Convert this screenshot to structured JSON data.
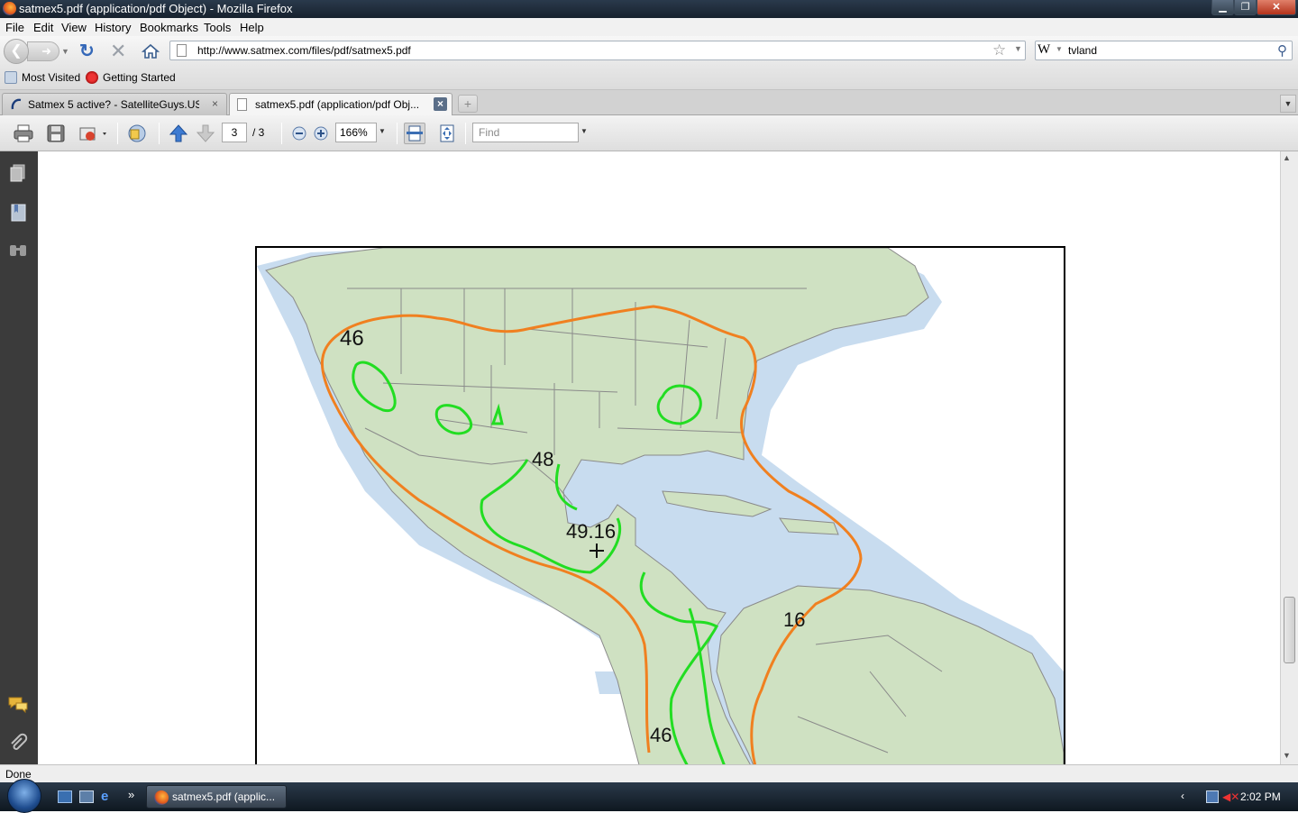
{
  "window": {
    "title": "satmex5.pdf (application/pdf Object) - Mozilla Firefox"
  },
  "menu": [
    {
      "label": "File"
    },
    {
      "label": "Edit"
    },
    {
      "label": "View"
    },
    {
      "label": "History"
    },
    {
      "label": "Bookmarks"
    },
    {
      "label": "Tools"
    },
    {
      "label": "Help"
    }
  ],
  "nav": {
    "url": "http://www.satmex.com/files/pdf/satmex5.pdf",
    "search_engine": "W",
    "search_value": "tvland"
  },
  "bookmarks": [
    {
      "label": "Most Visited"
    },
    {
      "label": "Getting Started"
    }
  ],
  "tabs": [
    {
      "label": "Satmex 5 active? - SatelliteGuys.US",
      "close": "×"
    },
    {
      "label": "satmex5.pdf (application/pdf Obj...",
      "close": "×"
    }
  ],
  "newtab": "+",
  "pdf_toolbar": {
    "page_current": "3",
    "page_total": "/ 3",
    "zoom": "166%",
    "find_placeholder": "Find"
  },
  "map": {
    "labels": {
      "contour_46_north": "46",
      "contour_48": "48",
      "contour_49": "49.16",
      "contour_46_south": "46",
      "contour_16": "16"
    },
    "colors": {
      "ocean_shelf": "#c8dcef",
      "land": "#cfe1c2",
      "border": "#8a8a8a",
      "contour_orange": "#f08020",
      "contour_green": "#22dd22"
    }
  },
  "status": {
    "text": "Done"
  },
  "taskbar": {
    "task_label": "satmex5.pdf (applic...",
    "clock": "2:02 PM",
    "more": "»"
  }
}
